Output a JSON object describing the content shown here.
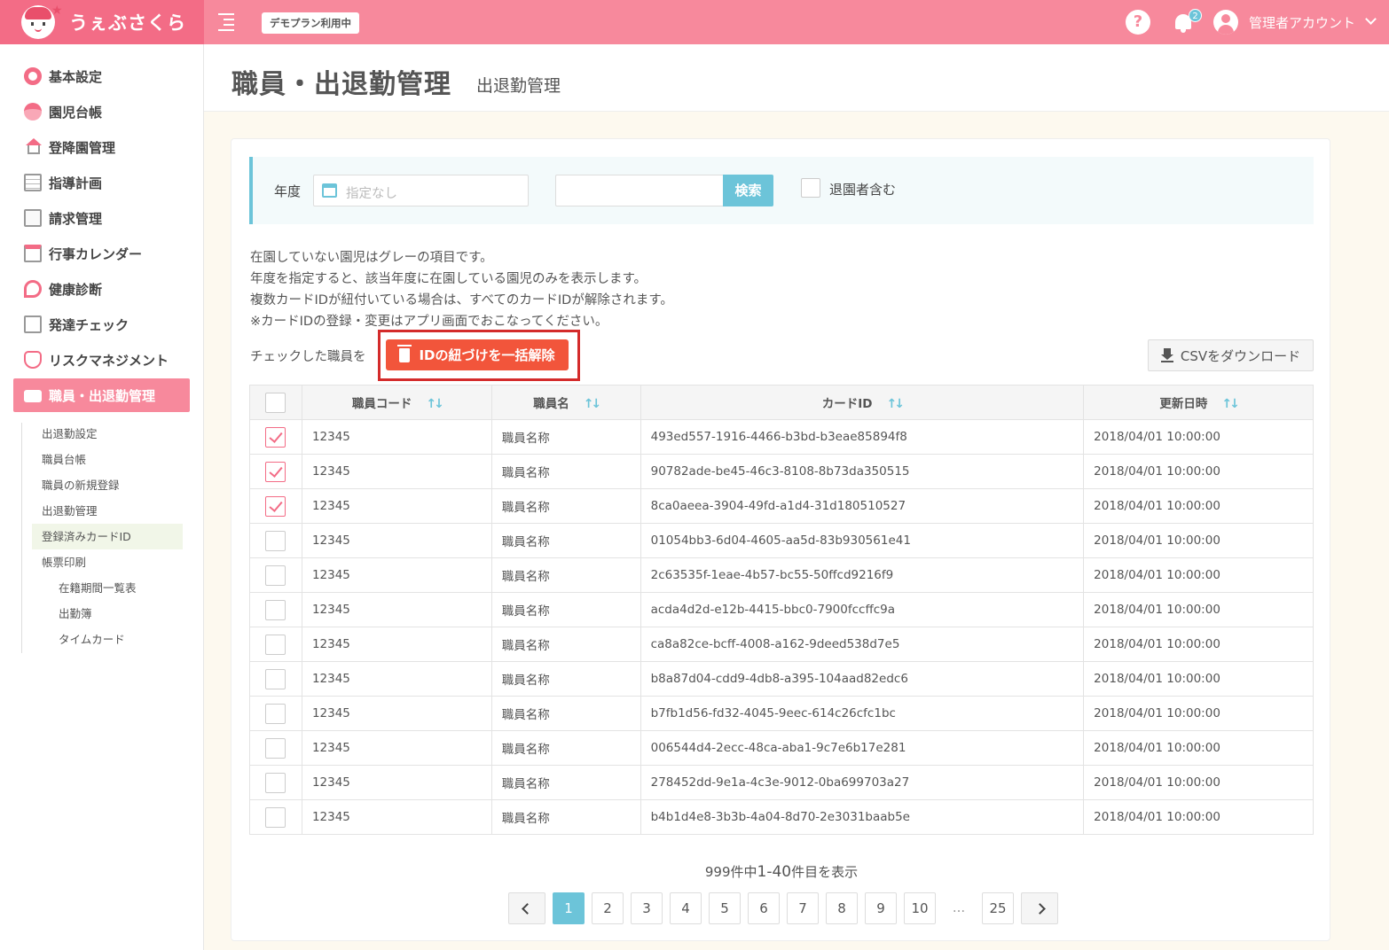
{
  "header": {
    "logo_text": "うぇぶさくら",
    "demo_badge": "デモプラン利用中",
    "notification_count": "2",
    "user_name": "管理者アカウント"
  },
  "sidebar": {
    "items": [
      {
        "label": "基本設定",
        "icon": "gear-icon"
      },
      {
        "label": "園児台帳",
        "icon": "child-face-icon"
      },
      {
        "label": "登降園管理",
        "icon": "house-icon"
      },
      {
        "label": "指導計画",
        "icon": "notebook-icon"
      },
      {
        "label": "請求管理",
        "icon": "calculator-icon"
      },
      {
        "label": "行事カレンダー",
        "icon": "calendar-icon"
      },
      {
        "label": "健康診断",
        "icon": "stethoscope-icon"
      },
      {
        "label": "発達チェック",
        "icon": "checklist-icon"
      },
      {
        "label": "リスクマネジメント",
        "icon": "hands-icon"
      },
      {
        "label": "職員・出退勤管理",
        "icon": "briefcase-icon"
      }
    ],
    "subitems": [
      {
        "label": "出退勤設定"
      },
      {
        "label": "職員台帳"
      },
      {
        "label": "職員の新規登録"
      },
      {
        "label": "出退勤管理"
      },
      {
        "label": "登録済みカードID"
      },
      {
        "label": "帳票印刷"
      },
      {
        "label": "在籍期間一覧表"
      },
      {
        "label": "出勤簿"
      },
      {
        "label": "タイムカード"
      }
    ]
  },
  "page": {
    "title": "職員・出退勤管理",
    "subtitle": "出退勤管理"
  },
  "filter": {
    "year_label": "年度",
    "year_placeholder": "指定なし",
    "search_value": "",
    "search_button": "検索",
    "include_retired_label": "退園者含む"
  },
  "notes": [
    "在園していない園児はグレーの項目です。",
    "年度を指定すると、該当年度に在園している園児のみを表示します。",
    "複数カードIDが紐付いている場合は、すべてのカードIDが解除されます。",
    "※カードIDの登録・変更はアプリ画面でおこなってください。"
  ],
  "actions": {
    "bulk_label": "チェックした職員を",
    "bulk_button": "IDの紐づけを一括解除",
    "csv_button": "CSVをダウンロード"
  },
  "table": {
    "headers": [
      "職員コード",
      "職員名",
      "カードID",
      "更新日時"
    ],
    "rows": [
      {
        "checked": true,
        "code": "12345",
        "name": "職員名称",
        "card_id": "493ed557-1916-4466-b3bd-b3eae85894f8",
        "updated": "2018/04/01 10:00:00"
      },
      {
        "checked": true,
        "code": "12345",
        "name": "職員名称",
        "card_id": "90782ade-be45-46c3-8108-8b73da350515",
        "updated": "2018/04/01 10:00:00"
      },
      {
        "checked": true,
        "code": "12345",
        "name": "職員名称",
        "card_id": "8ca0aeea-3904-49fd-a1d4-31d180510527",
        "updated": "2018/04/01 10:00:00"
      },
      {
        "checked": false,
        "code": "12345",
        "name": "職員名称",
        "card_id": "01054bb3-6d04-4605-aa5d-83b930561e41",
        "updated": "2018/04/01 10:00:00"
      },
      {
        "checked": false,
        "code": "12345",
        "name": "職員名称",
        "card_id": "2c63535f-1eae-4b57-bc55-50ffcd9216f9",
        "updated": "2018/04/01 10:00:00"
      },
      {
        "checked": false,
        "code": "12345",
        "name": "職員名称",
        "card_id": "acda4d2d-e12b-4415-bbc0-7900fccffc9a",
        "updated": "2018/04/01 10:00:00"
      },
      {
        "checked": false,
        "code": "12345",
        "name": "職員名称",
        "card_id": "ca8a82ce-bcff-4008-a162-9deed538d7e5",
        "updated": "2018/04/01 10:00:00"
      },
      {
        "checked": false,
        "code": "12345",
        "name": "職員名称",
        "card_id": "b8a87d04-cdd9-4db8-a395-104aad82edc6",
        "updated": "2018/04/01 10:00:00"
      },
      {
        "checked": false,
        "code": "12345",
        "name": "職員名称",
        "card_id": "b7fb1d56-fd32-4045-9eec-614c26cfc1bc",
        "updated": "2018/04/01 10:00:00"
      },
      {
        "checked": false,
        "code": "12345",
        "name": "職員名称",
        "card_id": "006544d4-2ecc-48ca-aba1-9c7e6b17e281",
        "updated": "2018/04/01 10:00:00"
      },
      {
        "checked": false,
        "code": "12345",
        "name": "職員名称",
        "card_id": "278452dd-9e1a-4c3e-9012-0ba699703a27",
        "updated": "2018/04/01 10:00:00"
      },
      {
        "checked": false,
        "code": "12345",
        "name": "職員名称",
        "card_id": "b4b1d4e8-3b3b-4a04-8d70-2e3031baab5e",
        "updated": "2018/04/01 10:00:00"
      }
    ]
  },
  "pagination": {
    "summary_total": "999件中",
    "summary_range": "1-40",
    "summary_suffix": "件目を表示",
    "pages": [
      "1",
      "2",
      "3",
      "4",
      "5",
      "6",
      "7",
      "8",
      "9",
      "10"
    ],
    "ellipsis": "...",
    "last_page": "25",
    "current": "1"
  },
  "colors": {
    "header_bg": "#f7899c",
    "logo_bg": "#f36c86",
    "accent_blue": "#6cc4d9",
    "danger": "#f2553b",
    "highlight_frame": "#d42b2b"
  }
}
